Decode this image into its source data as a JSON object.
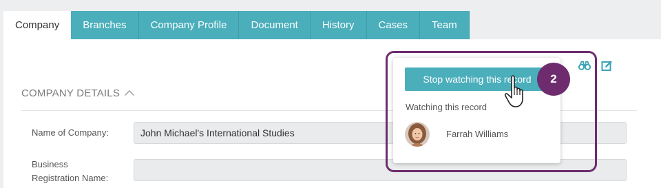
{
  "tabs": [
    {
      "label": "Company",
      "active": true
    },
    {
      "label": "Branches"
    },
    {
      "label": "Company Profile"
    },
    {
      "label": "Document"
    },
    {
      "label": "History"
    },
    {
      "label": "Cases"
    },
    {
      "label": "Team"
    }
  ],
  "toolbar": {
    "watch_icon": "binoculars-icon",
    "edit_icon": "edit-icon"
  },
  "section": {
    "title": "COMPANY DETAILS",
    "toggle_icon": "chevron-up-icon"
  },
  "fields": {
    "company_name_label": "Name of Company:",
    "company_name_value": "John Michael's International Studies",
    "business_reg_label_line1": "Business",
    "business_reg_label_line2": "Registration Name:",
    "business_reg_value": ""
  },
  "watch_popup": {
    "button_label": "Stop watching this record",
    "watching_label": "Watching this record",
    "watchers": [
      {
        "name": "Farrah Williams"
      }
    ]
  },
  "annotation": {
    "step_number": "2",
    "accent_color": "#6e2c6f"
  },
  "colors": {
    "tab_teal": "#4aaebb",
    "icon_teal": "#3aa3b6"
  }
}
